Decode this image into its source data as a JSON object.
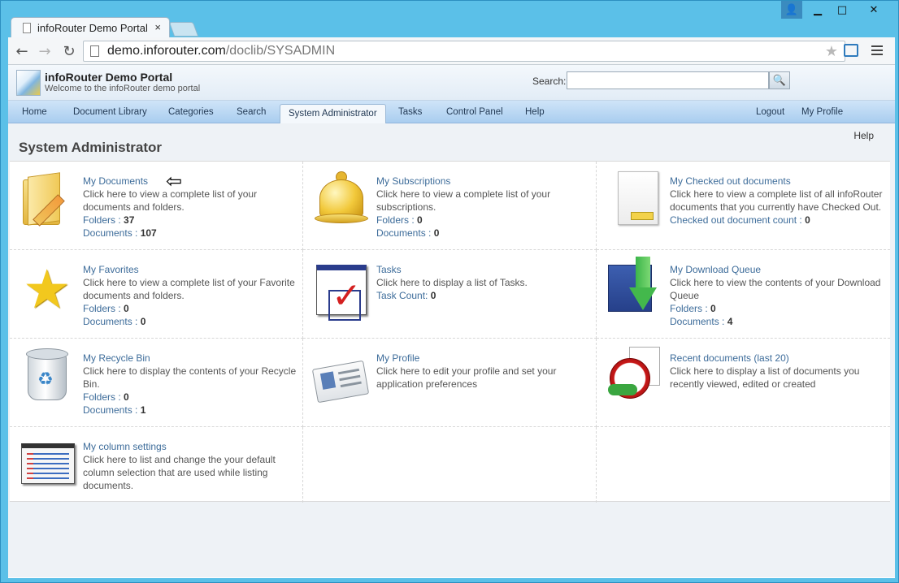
{
  "browser": {
    "tab_title": "infoRouter Demo Portal",
    "tab_close": "×",
    "url_host": "demo.inforouter.com",
    "url_path": "/doclib/SYSADMIN",
    "window_user": "👤",
    "window_min": "▁",
    "window_max": "□",
    "window_close": "✕"
  },
  "header": {
    "brand_title": "infoRouter Demo Portal",
    "brand_subtitle": "Welcome to the infoRouter demo portal",
    "search_label": "Search:",
    "search_value": "",
    "search_button": "🔍"
  },
  "nav": {
    "home": "Home",
    "document_library": "Document Library",
    "categories": "Categories",
    "search": "Search",
    "system_administrator": "System Administrator",
    "tasks": "Tasks",
    "control_panel": "Control Panel",
    "help": "Help",
    "logout": "Logout",
    "my_profile": "My Profile"
  },
  "page": {
    "help_link": "Help",
    "title": "System Administrator"
  },
  "cards": {
    "my_documents": {
      "title": "My Documents",
      "desc": "Click here to view a complete list of your documents and folders.",
      "folders_label": "Folders : ",
      "folders": "37",
      "documents_label": "Documents : ",
      "documents": "107"
    },
    "my_subscriptions": {
      "title": "My Subscriptions",
      "desc": "Click here to view a complete list of your subscriptions.",
      "folders_label": "Folders : ",
      "folders": "0",
      "documents_label": "Documents : ",
      "documents": "0"
    },
    "my_checked_out": {
      "title": "My Checked out documents",
      "desc": "Click here to view a complete list of all infoRouter documents that you currently have Checked Out.",
      "count_label": "Checked out document count : ",
      "count": "0"
    },
    "my_favorites": {
      "title": "My Favorites",
      "desc": "Click here to view a complete list of your Favorite documents and folders.",
      "folders_label": "Folders : ",
      "folders": "0",
      "documents_label": "Documents : ",
      "documents": "0"
    },
    "tasks": {
      "title": "Tasks",
      "desc": "Click here to display a list of Tasks.",
      "count_label": "Task Count: ",
      "count": "0"
    },
    "my_download_queue": {
      "title": "My Download Queue",
      "desc": "Click here to view the contents of your Download Queue",
      "folders_label": "Folders : ",
      "folders": "0",
      "documents_label": "Documents : ",
      "documents": "4"
    },
    "my_recycle_bin": {
      "title": "My Recycle Bin",
      "desc": "Click here to display the contents of your Recycle Bin.",
      "folders_label": "Folders : ",
      "folders": "0",
      "documents_label": "Documents : ",
      "documents": "1"
    },
    "my_profile": {
      "title": "My Profile",
      "desc": "Click here to edit your profile and set your application preferences"
    },
    "recent_documents": {
      "title": "Recent documents (last 20)",
      "desc": "Click here to display a list of documents you recently viewed, edited or created"
    },
    "my_column_settings": {
      "title": "My column settings",
      "desc": "Click here to list and change the your default column selection that are used while listing documents."
    }
  },
  "annotation": {
    "arrow": "⇦"
  },
  "colors": {
    "accent": "#3d6c9a",
    "nav_bg": "#a9cdef",
    "frame": "#5bc0e8"
  },
  "icons": [
    "folder-icon",
    "bell-icon",
    "checked-out-doc-icon",
    "star-icon",
    "tasks-icon",
    "download-queue-icon",
    "recycle-bin-icon",
    "profile-card-icon",
    "recent-docs-clock-icon",
    "column-settings-icon"
  ]
}
